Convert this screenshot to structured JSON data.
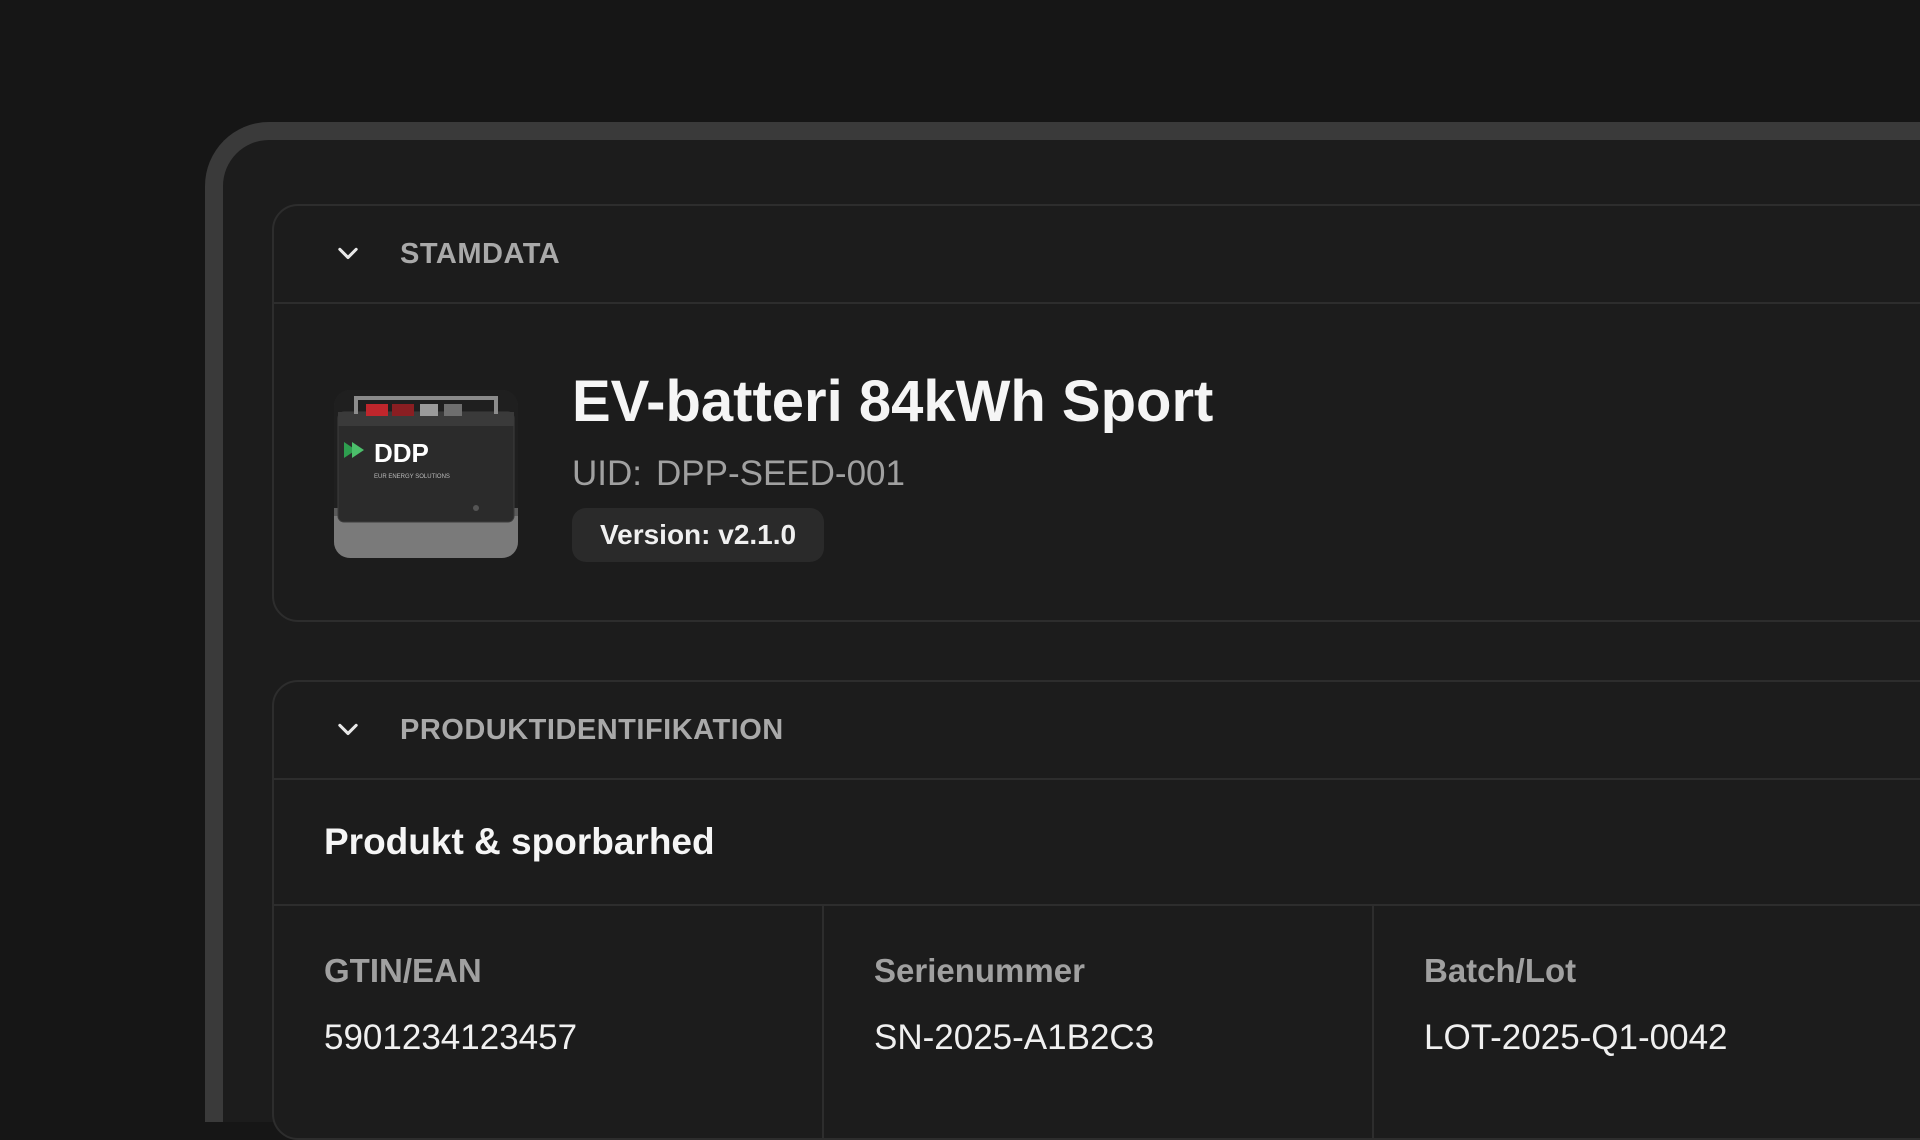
{
  "sections": {
    "stamdata": {
      "title": "STAMDATA",
      "product_name": "EV-batteri 84kWh Sport",
      "uid_label": "UID:",
      "uid_value": "DPP-SEED-001",
      "version": "Version: v2.1.0",
      "image_logo_text": "DDP",
      "image_logo_subtext": "EUR ENERGY SOLUTIONS"
    },
    "produktidentifikation": {
      "title": "PRODUKTIDENTIFIKATION",
      "subtitle": "Produkt & sporbarhed",
      "fields": [
        {
          "label": "GTIN/EAN",
          "value": "5901234123457"
        },
        {
          "label": "Serienummer",
          "value": "SN-2025-A1B2C3"
        },
        {
          "label": "Batch/Lot",
          "value": "LOT-2025-Q1-0042"
        }
      ]
    }
  },
  "colors": {
    "background": "#161616",
    "card": "#1c1c1c",
    "border": "#2d2d2d",
    "text_primary": "#f5f5f5",
    "text_secondary": "#a0a0a0",
    "logo_green": "#2e9e4f"
  },
  "icons": {
    "collapse": "chevron-down-icon"
  }
}
